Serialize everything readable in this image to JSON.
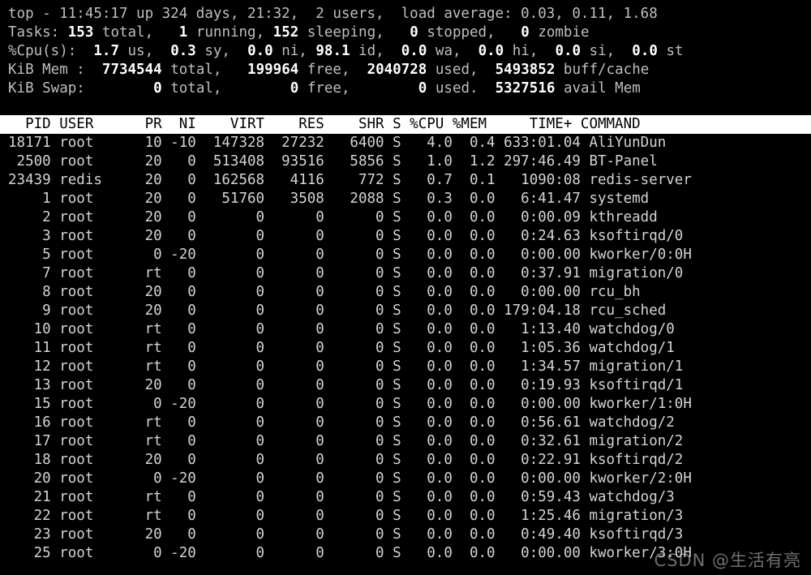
{
  "terminal": {
    "background": "#000000",
    "foreground": "#c8c8c8",
    "highlight_bg": "#ffffff",
    "highlight_fg": "#000000"
  },
  "summary": {
    "uptime_line": {
      "program": "top",
      "sep": " - ",
      "time": "11:45:17",
      "up_label": " up ",
      "up_days": "324 days, 21:32,",
      "users": "  2 users,",
      "load_label": "  load average: ",
      "load_values": "0.03, 0.11, 1.68",
      "full": "top - 11:45:17 up 324 days, 21:32,  2 users,  load average: 0.03, 0.11, 1.68"
    },
    "tasks_line": {
      "label": "Tasks:",
      "total": "153",
      "total_label": " total,",
      "running": "1",
      "running_label": " running,",
      "sleeping": "152",
      "sleeping_label": " sleeping,",
      "stopped": "0",
      "stopped_label": " stopped,",
      "zombie": "0",
      "zombie_label": " zombie",
      "full": "Tasks: 153 total,   1 running, 152 sleeping,   0 stopped,   0 zombie"
    },
    "cpu_line": {
      "label": "%Cpu(s):",
      "us": "1.7",
      "us_label": " us,",
      "sy": "0.3",
      "sy_label": " sy,",
      "ni": "0.0",
      "ni_label": " ni,",
      "id": "98.1",
      "id_label": " id,",
      "wa": "0.0",
      "wa_label": " wa,",
      "hi": "0.0",
      "hi_label": " hi,",
      "si": "0.0",
      "si_label": " si,",
      "st": "0.0",
      "st_label": " st",
      "full": "%Cpu(s):  1.7 us,  0.3 sy,  0.0 ni, 98.1 id,  0.0 wa,  0.0 hi,  0.0 si,  0.0 st"
    },
    "mem_line": {
      "label": "KiB Mem :",
      "total": "7734544",
      "total_label": " total,",
      "free": "199964",
      "free_label": " free,",
      "used": "2040728",
      "used_label": " used,",
      "buff": "5493852",
      "buff_label": " buff/cache",
      "full": "KiB Mem :  7734544 total,   199964 free,  2040728 used,  5493852 buff/cache"
    },
    "swap_line": {
      "label": "KiB Swap:",
      "total": "0",
      "total_label": " total,",
      "free": "0",
      "free_label": " free,",
      "used": "0",
      "used_label": " used.",
      "avail": "5327516",
      "avail_label": " avail Mem",
      "full": "KiB Swap:        0 total,        0 free,        0 used.  5327516 avail Mem"
    }
  },
  "table": {
    "header_text": "  PID USER      PR  NI    VIRT    RES    SHR S %CPU %MEM     TIME+ COMMAND                      ",
    "columns": [
      "PID",
      "USER",
      "PR",
      "NI",
      "VIRT",
      "RES",
      "SHR",
      "S",
      "%CPU",
      "%MEM",
      "TIME+",
      "COMMAND"
    ],
    "rows": [
      {
        "pid": "18171",
        "user": "root",
        "pr": "10",
        "ni": "-10",
        "virt": "147328",
        "res": "27232",
        "shr": "6400",
        "s": "S",
        "cpu": "4.0",
        "mem": "0.4",
        "time": "633:01.04",
        "command": "AliYunDun",
        "text": "18171 root      10 -10  147328  27232   6400 S   4.0  0.4 633:01.04 AliYunDun"
      },
      {
        "pid": "2500",
        "user": "root",
        "pr": "20",
        "ni": "0",
        "virt": "513408",
        "res": "93516",
        "shr": "5856",
        "s": "S",
        "cpu": "1.0",
        "mem": "1.2",
        "time": "297:46.49",
        "command": "BT-Panel",
        "text": " 2500 root      20   0  513408  93516   5856 S   1.0  1.2 297:46.49 BT-Panel"
      },
      {
        "pid": "23439",
        "user": "redis",
        "pr": "20",
        "ni": "0",
        "virt": "162568",
        "res": "4116",
        "shr": "772",
        "s": "S",
        "cpu": "0.7",
        "mem": "0.1",
        "time": "1090:08",
        "command": "redis-server",
        "text": "23439 redis     20   0  162568   4116    772 S   0.7  0.1   1090:08 redis-server"
      },
      {
        "pid": "1",
        "user": "root",
        "pr": "20",
        "ni": "0",
        "virt": "51760",
        "res": "3508",
        "shr": "2088",
        "s": "S",
        "cpu": "0.3",
        "mem": "0.0",
        "time": "6:41.47",
        "command": "systemd",
        "text": "    1 root      20   0   51760   3508   2088 S   0.3  0.0   6:41.47 systemd"
      },
      {
        "pid": "2",
        "user": "root",
        "pr": "20",
        "ni": "0",
        "virt": "0",
        "res": "0",
        "shr": "0",
        "s": "S",
        "cpu": "0.0",
        "mem": "0.0",
        "time": "0:00.09",
        "command": "kthreadd",
        "text": "    2 root      20   0       0      0      0 S   0.0  0.0   0:00.09 kthreadd"
      },
      {
        "pid": "3",
        "user": "root",
        "pr": "20",
        "ni": "0",
        "virt": "0",
        "res": "0",
        "shr": "0",
        "s": "S",
        "cpu": "0.0",
        "mem": "0.0",
        "time": "0:24.63",
        "command": "ksoftirqd/0",
        "text": "    3 root      20   0       0      0      0 S   0.0  0.0   0:24.63 ksoftirqd/0"
      },
      {
        "pid": "5",
        "user": "root",
        "pr": "0",
        "ni": "-20",
        "virt": "0",
        "res": "0",
        "shr": "0",
        "s": "S",
        "cpu": "0.0",
        "mem": "0.0",
        "time": "0:00.00",
        "command": "kworker/0:0H",
        "text": "    5 root       0 -20       0      0      0 S   0.0  0.0   0:00.00 kworker/0:0H"
      },
      {
        "pid": "7",
        "user": "root",
        "pr": "rt",
        "ni": "0",
        "virt": "0",
        "res": "0",
        "shr": "0",
        "s": "S",
        "cpu": "0.0",
        "mem": "0.0",
        "time": "0:37.91",
        "command": "migration/0",
        "text": "    7 root      rt   0       0      0      0 S   0.0  0.0   0:37.91 migration/0"
      },
      {
        "pid": "8",
        "user": "root",
        "pr": "20",
        "ni": "0",
        "virt": "0",
        "res": "0",
        "shr": "0",
        "s": "S",
        "cpu": "0.0",
        "mem": "0.0",
        "time": "0:00.00",
        "command": "rcu_bh",
        "text": "    8 root      20   0       0      0      0 S   0.0  0.0   0:00.00 rcu_bh"
      },
      {
        "pid": "9",
        "user": "root",
        "pr": "20",
        "ni": "0",
        "virt": "0",
        "res": "0",
        "shr": "0",
        "s": "S",
        "cpu": "0.0",
        "mem": "0.0",
        "time": "179:04.18",
        "command": "rcu_sched",
        "text": "    9 root      20   0       0      0      0 S   0.0  0.0 179:04.18 rcu_sched"
      },
      {
        "pid": "10",
        "user": "root",
        "pr": "rt",
        "ni": "0",
        "virt": "0",
        "res": "0",
        "shr": "0",
        "s": "S",
        "cpu": "0.0",
        "mem": "0.0",
        "time": "1:13.40",
        "command": "watchdog/0",
        "text": "   10 root      rt   0       0      0      0 S   0.0  0.0   1:13.40 watchdog/0"
      },
      {
        "pid": "11",
        "user": "root",
        "pr": "rt",
        "ni": "0",
        "virt": "0",
        "res": "0",
        "shr": "0",
        "s": "S",
        "cpu": "0.0",
        "mem": "0.0",
        "time": "1:05.36",
        "command": "watchdog/1",
        "text": "   11 root      rt   0       0      0      0 S   0.0  0.0   1:05.36 watchdog/1"
      },
      {
        "pid": "12",
        "user": "root",
        "pr": "rt",
        "ni": "0",
        "virt": "0",
        "res": "0",
        "shr": "0",
        "s": "S",
        "cpu": "0.0",
        "mem": "0.0",
        "time": "1:34.57",
        "command": "migration/1",
        "text": "   12 root      rt   0       0      0      0 S   0.0  0.0   1:34.57 migration/1"
      },
      {
        "pid": "13",
        "user": "root",
        "pr": "20",
        "ni": "0",
        "virt": "0",
        "res": "0",
        "shr": "0",
        "s": "S",
        "cpu": "0.0",
        "mem": "0.0",
        "time": "0:19.93",
        "command": "ksoftirqd/1",
        "text": "   13 root      20   0       0      0      0 S   0.0  0.0   0:19.93 ksoftirqd/1"
      },
      {
        "pid": "15",
        "user": "root",
        "pr": "0",
        "ni": "-20",
        "virt": "0",
        "res": "0",
        "shr": "0",
        "s": "S",
        "cpu": "0.0",
        "mem": "0.0",
        "time": "0:00.00",
        "command": "kworker/1:0H",
        "text": "   15 root       0 -20       0      0      0 S   0.0  0.0   0:00.00 kworker/1:0H"
      },
      {
        "pid": "16",
        "user": "root",
        "pr": "rt",
        "ni": "0",
        "virt": "0",
        "res": "0",
        "shr": "0",
        "s": "S",
        "cpu": "0.0",
        "mem": "0.0",
        "time": "0:56.61",
        "command": "watchdog/2",
        "text": "   16 root      rt   0       0      0      0 S   0.0  0.0   0:56.61 watchdog/2"
      },
      {
        "pid": "17",
        "user": "root",
        "pr": "rt",
        "ni": "0",
        "virt": "0",
        "res": "0",
        "shr": "0",
        "s": "S",
        "cpu": "0.0",
        "mem": "0.0",
        "time": "0:32.61",
        "command": "migration/2",
        "text": "   17 root      rt   0       0      0      0 S   0.0  0.0   0:32.61 migration/2"
      },
      {
        "pid": "18",
        "user": "root",
        "pr": "20",
        "ni": "0",
        "virt": "0",
        "res": "0",
        "shr": "0",
        "s": "S",
        "cpu": "0.0",
        "mem": "0.0",
        "time": "0:22.91",
        "command": "ksoftirqd/2",
        "text": "   18 root      20   0       0      0      0 S   0.0  0.0   0:22.91 ksoftirqd/2"
      },
      {
        "pid": "20",
        "user": "root",
        "pr": "0",
        "ni": "-20",
        "virt": "0",
        "res": "0",
        "shr": "0",
        "s": "S",
        "cpu": "0.0",
        "mem": "0.0",
        "time": "0:00.00",
        "command": "kworker/2:0H",
        "text": "   20 root       0 -20       0      0      0 S   0.0  0.0   0:00.00 kworker/2:0H"
      },
      {
        "pid": "21",
        "user": "root",
        "pr": "rt",
        "ni": "0",
        "virt": "0",
        "res": "0",
        "shr": "0",
        "s": "S",
        "cpu": "0.0",
        "mem": "0.0",
        "time": "0:59.43",
        "command": "watchdog/3",
        "text": "   21 root      rt   0       0      0      0 S   0.0  0.0   0:59.43 watchdog/3"
      },
      {
        "pid": "22",
        "user": "root",
        "pr": "rt",
        "ni": "0",
        "virt": "0",
        "res": "0",
        "shr": "0",
        "s": "S",
        "cpu": "0.0",
        "mem": "0.0",
        "time": "1:25.46",
        "command": "migration/3",
        "text": "   22 root      rt   0       0      0      0 S   0.0  0.0   1:25.46 migration/3"
      },
      {
        "pid": "23",
        "user": "root",
        "pr": "20",
        "ni": "0",
        "virt": "0",
        "res": "0",
        "shr": "0",
        "s": "S",
        "cpu": "0.0",
        "mem": "0.0",
        "time": "0:49.40",
        "command": "ksoftirqd/3",
        "text": "   23 root      20   0       0      0      0 S   0.0  0.0   0:49.40 ksoftirqd/3"
      },
      {
        "pid": "25",
        "user": "root",
        "pr": "0",
        "ni": "-20",
        "virt": "0",
        "res": "0",
        "shr": "0",
        "s": "S",
        "cpu": "0.0",
        "mem": "0.0",
        "time": "0:00.00",
        "command": "kworker/3:0H",
        "text": "   25 root       0 -20       0      0      0 S   0.0  0.0   0:00.00 kworker/3:0H"
      }
    ]
  },
  "watermark": {
    "text": "CSDN @生活有亮"
  }
}
